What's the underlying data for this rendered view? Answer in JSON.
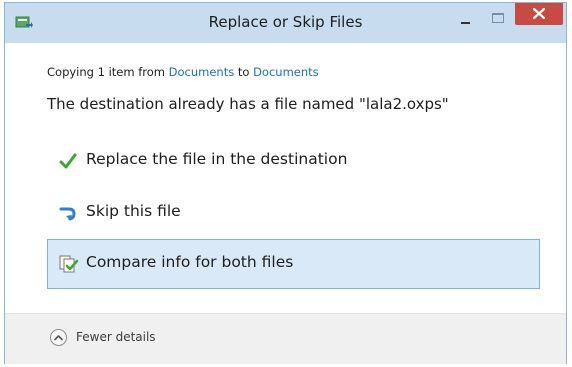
{
  "window": {
    "title": "Replace or Skip Files"
  },
  "header": {
    "copying_prefix": "Copying 1 item from ",
    "source_link": "Documents",
    "to_word": " to ",
    "dest_link": "Documents",
    "destination_message": "The destination already has a file named \"lala2.oxps\""
  },
  "options": {
    "replace": {
      "label": "Replace the file in the destination",
      "icon": "checkmark-icon"
    },
    "skip": {
      "label": "Skip this file",
      "icon": "skip-arrow-icon"
    },
    "compare": {
      "label": "Compare info for both files",
      "icon": "compare-files-icon"
    }
  },
  "footer": {
    "fewer_details_label": "Fewer details",
    "icon": "chevron-up-icon"
  },
  "colors": {
    "titlebar": "#c7dcee",
    "close_button": "#c74b42",
    "link": "#1c6fb8",
    "selected_option_bg": "#dae9f8",
    "selected_option_border": "#7db2e0",
    "checkmark": "#3fa535",
    "skip_arrow": "#2e7fd0"
  }
}
